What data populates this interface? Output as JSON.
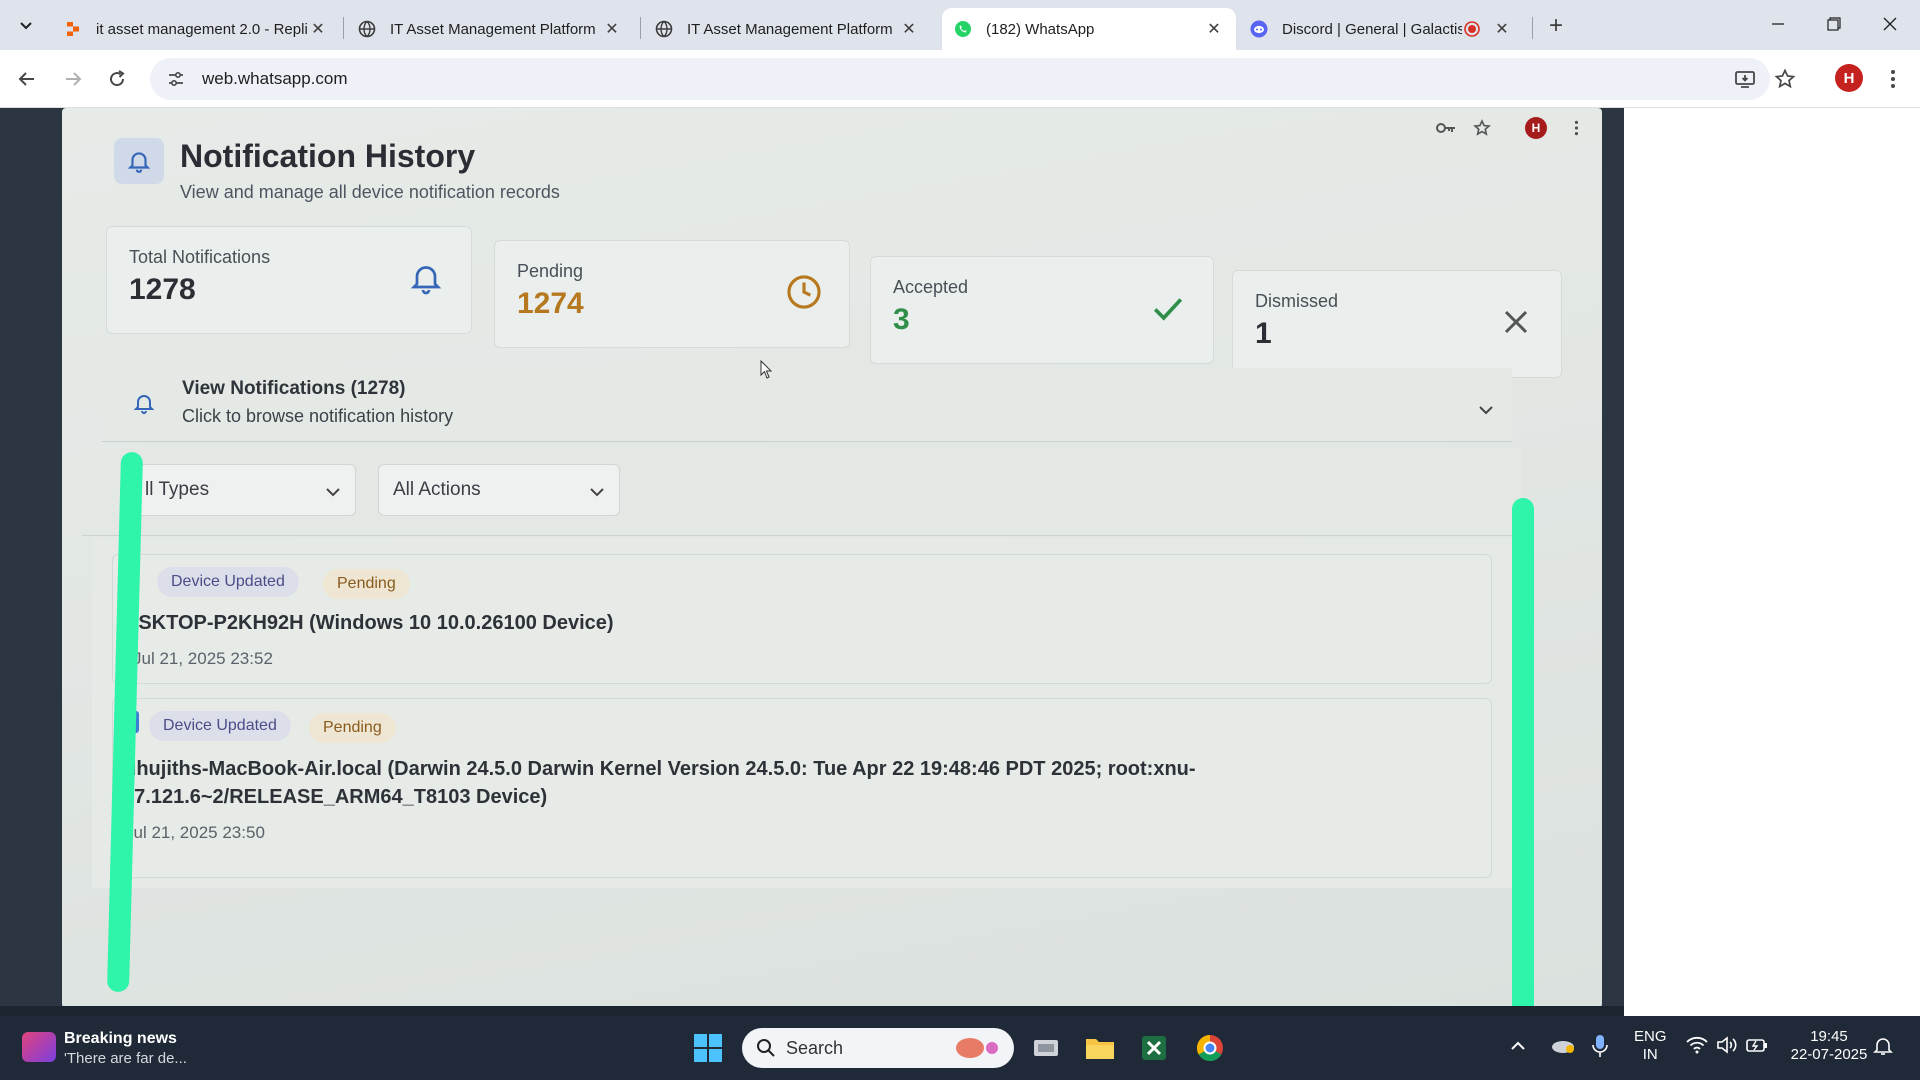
{
  "browser": {
    "tabs": [
      {
        "title": "it asset management 2.0 - Repli",
        "favicon": "replit-icon"
      },
      {
        "title": "IT Asset Management Platform",
        "favicon": "globe-icon"
      },
      {
        "title": "IT Asset Management Platform",
        "favicon": "globe-icon"
      },
      {
        "title": "(182) WhatsApp",
        "favicon": "whatsapp-icon",
        "active": true
      },
      {
        "title": "Discord | General | Galactis",
        "favicon": "discord-icon",
        "recording": true
      }
    ],
    "url": "web.whatsapp.com",
    "profile_initial": "H"
  },
  "page": {
    "title": "Notification History",
    "subtitle": "View and manage all device notification records",
    "profile_initial": "H",
    "stats": [
      {
        "label": "Total Notifications",
        "value": "1278",
        "icon": "bell-icon",
        "color": "#2b2f35"
      },
      {
        "label": "Pending",
        "value": "1274",
        "icon": "clock-icon",
        "color": "#b7791f"
      },
      {
        "label": "Accepted",
        "value": "3",
        "icon": "check-icon",
        "color": "#2f8f4a"
      },
      {
        "label": "Dismissed",
        "value": "1",
        "icon": "x-icon",
        "color": "#2b2f35"
      }
    ],
    "view_bar": {
      "title": "View Notifications (1278)",
      "subtitle": "Click to browse notification history"
    },
    "filters": {
      "types": "ll Types",
      "actions": "All Actions"
    },
    "notifications": [
      {
        "type": "Device Updated",
        "status": "Pending",
        "device": "ESKTOP-P2KH92H (Windows 10 10.0.26100 Device)",
        "time": "Jul 21, 2025 23:52"
      },
      {
        "type": "Device Updated",
        "status": "Pending",
        "device_line1": "adhujiths-MacBook-Air.local (Darwin 24.5.0 Darwin Kernel Version 24.5.0: Tue Apr 22 19:48:46 PDT 2025; root:xnu-",
        "device_line2": "117.121.6~2/RELEASE_ARM64_T8103 Device)",
        "time": "Jul 21, 2025 23:50"
      }
    ],
    "marker_color": "#2ef5a9"
  },
  "taskbar": {
    "news_title": "Breaking news",
    "news_text": "'There are far de...",
    "search_label": "Search",
    "lang_line1": "ENG",
    "lang_line2": "IN",
    "time": "19:45",
    "date": "22-07-2025"
  }
}
